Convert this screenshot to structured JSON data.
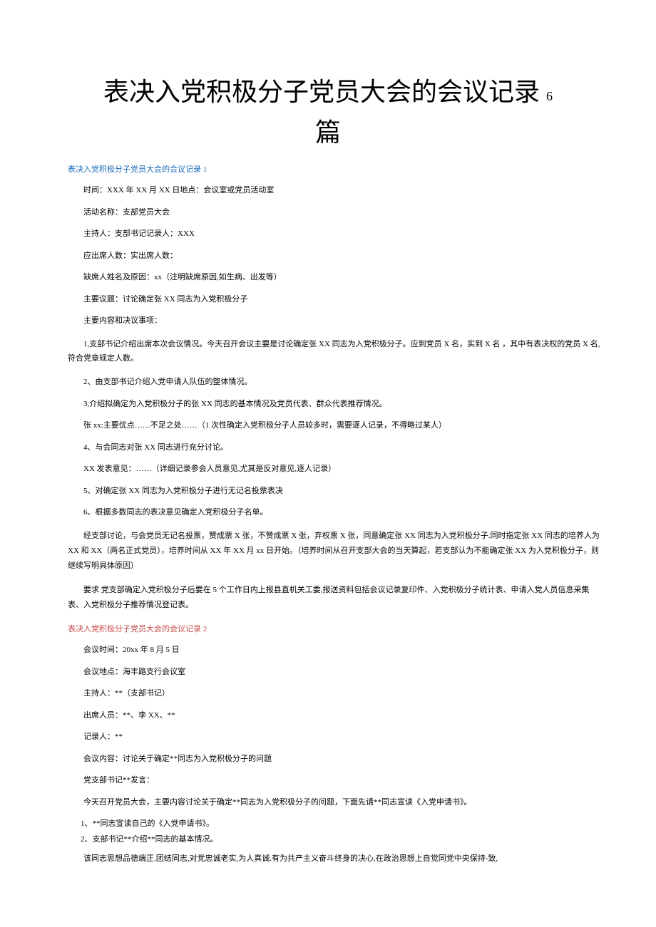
{
  "title_main": "表决入党积极分子党员大会的会议记录",
  "title_suffix": "6",
  "title_sub": "篇",
  "section1": {
    "heading": "表决入党积极分子党员大会的会议记录 1",
    "p1": "时间：XXX 年 XX 月 XX 日地点：会议室或党员活动室",
    "p2": "活动名称：支部党员大会",
    "p3": "主持人：支部书记记录人：XXX",
    "p4": "应出席人数：实出席人数：",
    "p5": "缺席人姓名及原因：xx（注明缺席原因,如生病、出发等）",
    "p6": "主要议题：讨论确定张 XX 同志为入党积极分子",
    "p7": "主要内容和决议事项：",
    "p8": "1,支部书记介绍出席本次会议情况。今天召开会议主要是讨论确定张 XX 同志为入党积极分子。应到党员 X 名，实到 X 名 ，其中有表决权的党员 X 名,  符合党章规定人数。",
    "p9": "2、由支部书记介绍入党申请人队伍的整体情况。",
    "p10": "3,介绍拟确定为入党积极分子的张 XX 同志的基本情况及党员代表、群众代表推荐情况。",
    "p11": "张 xx:主要优点……不足之处……（1 次性确定入党积极分子人员较多时，需要逐人记录，不得略过某人）",
    "p12": "4、与会同志对张 XX 同志进行充分讨论。",
    "p13": "XX 发表意见：……（详细记录参会人员意见,尤其是反对意见,逐人记录）",
    "p14": "5、对确定张 XX 同志为入党积极分子进行无记名投票表决",
    "p15": "6、根据多数同志的表决意见确定入党积极分子名单。",
    "p16": "经支部讨论，与会党员无记名投票，赞成票 X 张，不赞成票 X 张，弃权票 X 张，同意确定张 XX 同志为入党积极分子.同时指定张 XX 同志的培养人为 XX 和 XX（两名正式党员），培养时间从 XX 年 XX 月 xx 日开始。（培养时间从召开支部大会的当天算起，若支部认为不能确定张 XX 为入党积极分子，则继续写明具体原因）",
    "p17": "要求  党支部确定入党积极分子后要在 5 个工作日内上报县直机关工委,报送资料包括会议记录复印件、入党积极分子统计表、申请入党人员信息采集表、入党积极分子推荐情况登记表。"
  },
  "section2": {
    "heading": "表决入党积极分子党员大会的会议记录 2",
    "p1": "会议时间：20xx 年 8 月 5 日",
    "p2": "会议地点：海丰路支行会议室",
    "p3": "主持人：**（支部书记）",
    "p4": "出席人员：**、李 XX、**",
    "p5": "记录人：**",
    "p6": "会议内容：讨论关于确定**同志为入党积极分子的问题",
    "p7": "党支部书记**发言：",
    "p8": "今天召开党员大会，主要内容讨论关于确定**同志为入党积极分子的问题，下面先请**同志宣读《入党申请书》。",
    "p9": "1、**同志宣读自己的《入党申请书》。",
    "p10": "2、支部书记**介绍**同志的基本情况。",
    "p11": "该同志思想品德端正.团结同志,对党忠诚老实,为人真诚.有为共产主义奋斗终身的决心,在政治思想上自觉同党中央保持-致,"
  }
}
